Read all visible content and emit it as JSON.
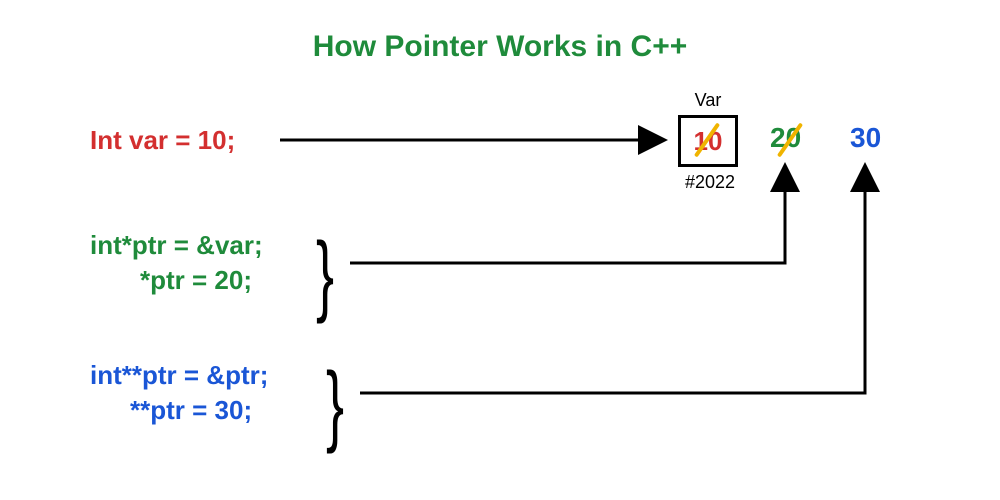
{
  "title": "How Pointer Works in C++",
  "var_label": "Var",
  "address_label": "#2022",
  "line1": "Int var = 10;",
  "line2a": "int*ptr = &var;",
  "line2b": "*ptr = 20;",
  "line3a": "int**ptr = &ptr;",
  "line3b": "**ptr = 30;",
  "val_initial": "10",
  "val_second": "20",
  "val_third": "30",
  "colors": {
    "red": "#d32f2f",
    "green": "#1f8b3b",
    "blue": "#1a56d6",
    "strike": "#f0b400"
  }
}
